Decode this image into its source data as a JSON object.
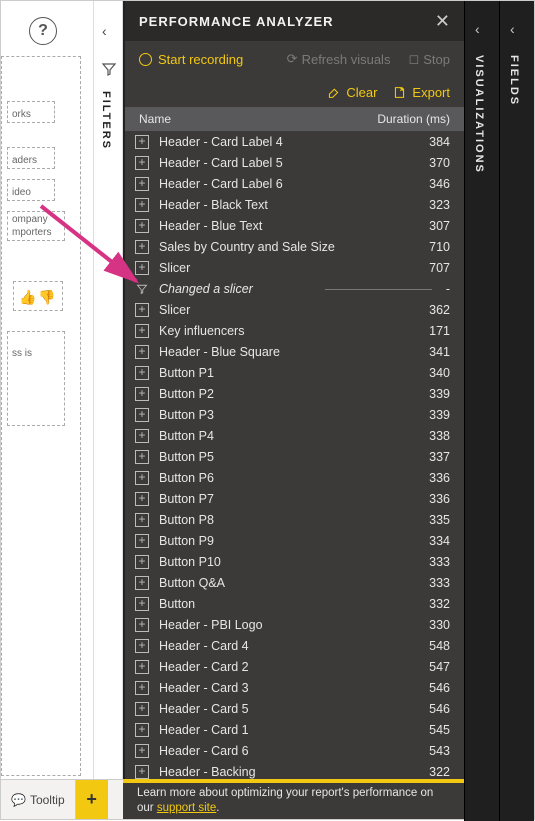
{
  "canvas": {
    "help_glyph": "?",
    "labels": [
      "orks",
      "aders",
      "ideo",
      "ompany",
      "mporters",
      "ss is"
    ]
  },
  "filters_rail": {
    "label": "FILTERS"
  },
  "panel": {
    "title": "PERFORMANCE ANALYZER",
    "toolbar": {
      "start_recording": "Start recording",
      "refresh": "Refresh visuals",
      "stop": "Stop"
    },
    "actions": {
      "clear": "Clear",
      "export": "Export"
    },
    "headers": {
      "name": "Name",
      "duration": "Duration (ms)"
    }
  },
  "rows": [
    {
      "type": "item",
      "name": "Header - Card Label 4",
      "duration": "384"
    },
    {
      "type": "item",
      "name": "Header - Card Label 5",
      "duration": "370"
    },
    {
      "type": "item",
      "name": "Header - Card Label 6",
      "duration": "346"
    },
    {
      "type": "item",
      "name": "Header - Black Text",
      "duration": "323"
    },
    {
      "type": "item",
      "name": "Header - Blue Text",
      "duration": "307"
    },
    {
      "type": "item",
      "name": "Sales by Country and Sale Size",
      "duration": "710"
    },
    {
      "type": "item",
      "name": "Slicer",
      "duration": "707"
    },
    {
      "type": "event",
      "name": "Changed a slicer",
      "duration": "-"
    },
    {
      "type": "item",
      "name": "Slicer",
      "duration": "362"
    },
    {
      "type": "item",
      "name": "Key influencers",
      "duration": "171"
    },
    {
      "type": "item",
      "name": "Header - Blue Square",
      "duration": "341"
    },
    {
      "type": "item",
      "name": "Button P1",
      "duration": "340"
    },
    {
      "type": "item",
      "name": "Button P2",
      "duration": "339"
    },
    {
      "type": "item",
      "name": "Button P3",
      "duration": "339"
    },
    {
      "type": "item",
      "name": "Button P4",
      "duration": "338"
    },
    {
      "type": "item",
      "name": "Button P5",
      "duration": "337"
    },
    {
      "type": "item",
      "name": "Button P6",
      "duration": "336"
    },
    {
      "type": "item",
      "name": "Button P7",
      "duration": "336"
    },
    {
      "type": "item",
      "name": "Button P8",
      "duration": "335"
    },
    {
      "type": "item",
      "name": "Button P9",
      "duration": "334"
    },
    {
      "type": "item",
      "name": "Button P10",
      "duration": "333"
    },
    {
      "type": "item",
      "name": "Button Q&A",
      "duration": "333"
    },
    {
      "type": "item",
      "name": "Button",
      "duration": "332"
    },
    {
      "type": "item",
      "name": "Header - PBI Logo",
      "duration": "330"
    },
    {
      "type": "item",
      "name": "Header - Card 4",
      "duration": "548"
    },
    {
      "type": "item",
      "name": "Header - Card 2",
      "duration": "547"
    },
    {
      "type": "item",
      "name": "Header - Card 3",
      "duration": "546"
    },
    {
      "type": "item",
      "name": "Header - Card 5",
      "duration": "546"
    },
    {
      "type": "item",
      "name": "Header - Card 1",
      "duration": "545"
    },
    {
      "type": "item",
      "name": "Header - Card 6",
      "duration": "543"
    },
    {
      "type": "item",
      "name": "Header - Backing",
      "duration": "322"
    }
  ],
  "footer": {
    "text_before": "Learn more about optimizing your report's performance on our ",
    "link": "support site",
    "text_after": "."
  },
  "bottom_bar": {
    "tab": "Tooltip"
  },
  "right_rails": {
    "visualizations": "VISUALIZATIONS",
    "fields": "FIELDS"
  }
}
